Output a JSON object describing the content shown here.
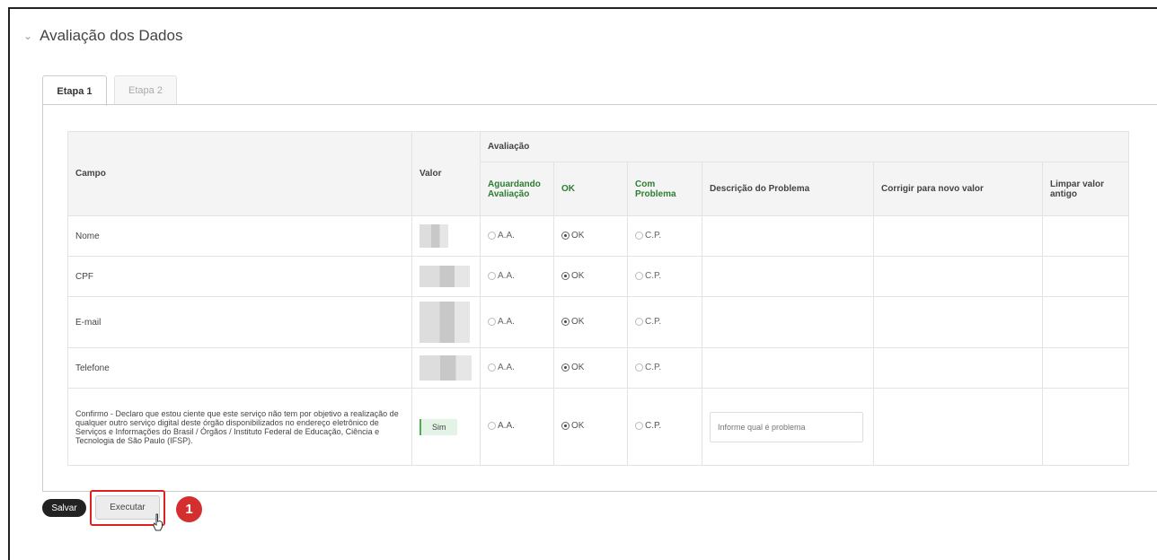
{
  "section": {
    "title": "Avaliação dos Dados"
  },
  "tabs": [
    {
      "label": "Etapa 1"
    },
    {
      "label": "Etapa 2"
    }
  ],
  "table": {
    "headers": {
      "campo": "Campo",
      "valor": "Valor",
      "avaliacao": "Avaliação",
      "aguardando": "Aguardando Avaliação",
      "ok": "OK",
      "com_problema": "Com Problema",
      "descricao": "Descrição do Problema",
      "corrigir": "Corrigir para novo valor",
      "limpar": "Limpar valor antigo"
    },
    "rows": [
      {
        "campo": "Nome"
      },
      {
        "campo": "CPF"
      },
      {
        "campo": "E-mail"
      },
      {
        "campo": "Telefone"
      },
      {
        "campo": "Confirmo - Declaro que estou ciente que este serviço não tem por objetivo a realização de qualquer outro serviço digital deste órgão disponibilizados no endereço eletrônico de Serviços e Informações do Brasil / Órgãos / Instituto Federal de Educação, Ciência e Tecnologia de São Paulo (IFSP).",
        "valor": "Sim"
      }
    ],
    "options": {
      "aa": "A.A.",
      "ok": "OK",
      "cp": "C.P."
    },
    "desc_placeholder": "Informe qual é problema"
  },
  "buttons": {
    "salvar": "Salvar",
    "executar": "Executar"
  },
  "annotation": {
    "step": "1"
  },
  "colors": {
    "accent_green": "#2e7d32",
    "highlight_red": "#e02020",
    "badge_red": "#d32f2f"
  }
}
